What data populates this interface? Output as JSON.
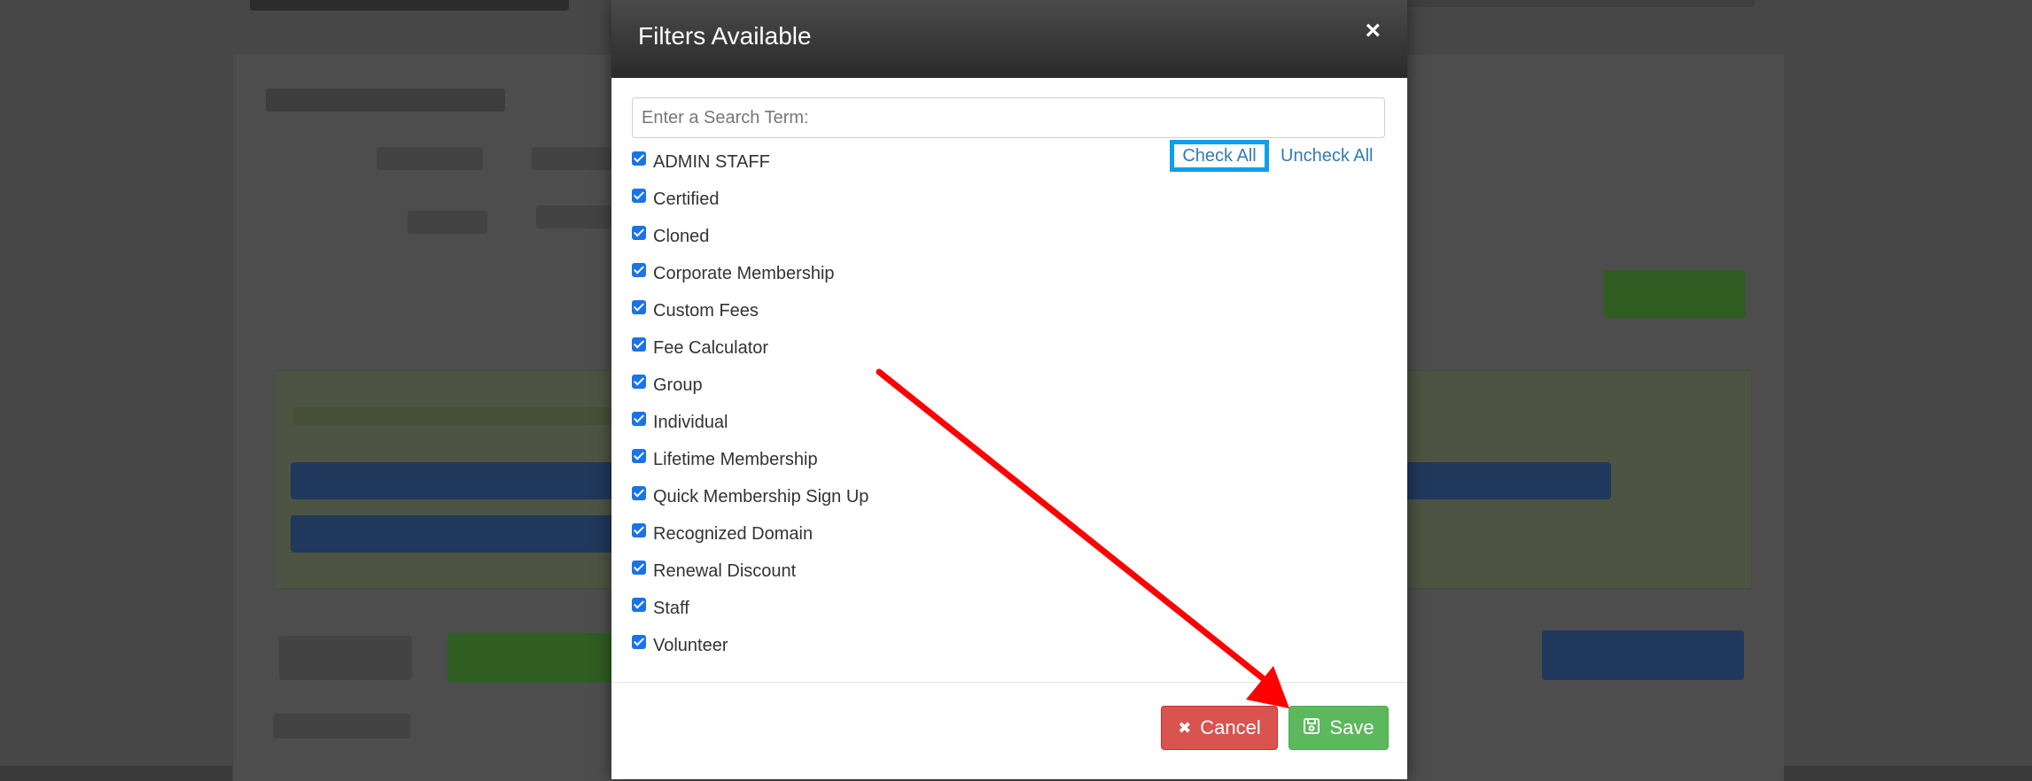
{
  "modal": {
    "title": "Filters Available",
    "close_glyph": "×",
    "search": {
      "placeholder": "Enter a Search Term:",
      "value": ""
    },
    "check_all_label": "Check All",
    "uncheck_all_label": "Uncheck All",
    "filters": [
      {
        "label": "ADMIN STAFF",
        "checked": true
      },
      {
        "label": "Certified",
        "checked": true
      },
      {
        "label": "Cloned",
        "checked": true
      },
      {
        "label": "Corporate Membership",
        "checked": true
      },
      {
        "label": "Custom Fees",
        "checked": true
      },
      {
        "label": "Fee Calculator",
        "checked": true
      },
      {
        "label": "Group",
        "checked": true
      },
      {
        "label": "Individual",
        "checked": true
      },
      {
        "label": "Lifetime Membership",
        "checked": true
      },
      {
        "label": "Quick Membership Sign Up",
        "checked": true
      },
      {
        "label": "Recognized Domain",
        "checked": true
      },
      {
        "label": "Renewal Discount",
        "checked": true
      },
      {
        "label": "Staff",
        "checked": true
      },
      {
        "label": "Volunteer",
        "checked": true
      }
    ],
    "footer": {
      "cancel_label": "Cancel",
      "cancel_icon": "x-icon",
      "save_label": "Save",
      "save_icon": "floppy-disk-icon"
    }
  },
  "colors": {
    "header_bg": "#333333",
    "link": "#337ab7",
    "highlight_border": "#0a9ff0",
    "cancel_bg": "#d9534f",
    "save_bg": "#5cb85c",
    "annotation_arrow": "#ff0000",
    "checkbox": "#1a73e8"
  }
}
